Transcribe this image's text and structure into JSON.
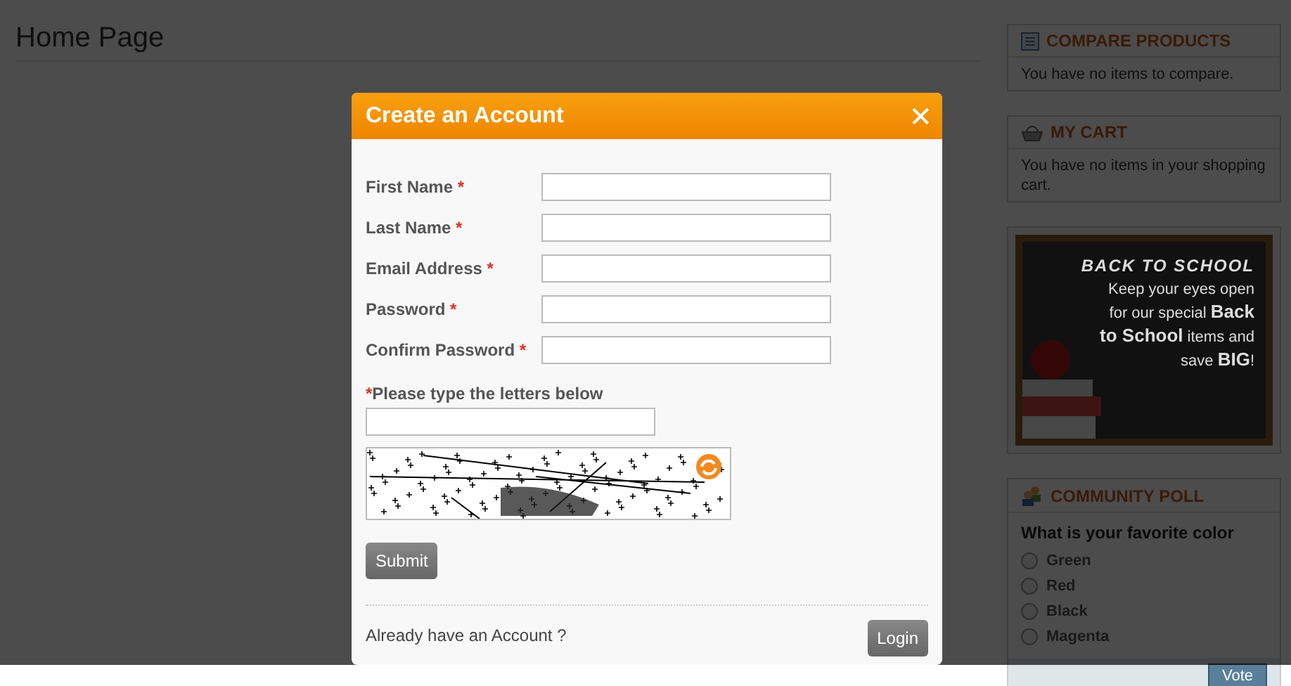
{
  "page": {
    "title": "Home Page"
  },
  "sidebar": {
    "compare": {
      "title": "COMPARE PRODUCTS",
      "text": "You have no items to compare."
    },
    "cart": {
      "title": "MY CART",
      "text": "You have no items in your shopping cart."
    },
    "banner": {
      "heading": "BACK TO SCHOOL",
      "text": "Keep your eyes open for our special **Back to School** items and save **BIG**!"
    },
    "poll": {
      "title": "COMMUNITY POLL",
      "question": "What is your favorite color",
      "options": [
        {
          "label": "Green",
          "selected": false
        },
        {
          "label": "Red",
          "selected": false
        },
        {
          "label": "Black",
          "selected": false
        },
        {
          "label": "Magenta",
          "selected": false
        }
      ],
      "button": "Vote"
    }
  },
  "dialog": {
    "title": "Create an Account",
    "close": "✕",
    "fields": [
      {
        "label": "First Name",
        "required_mark": "*"
      },
      {
        "label": "Last Name",
        "required_mark": "*"
      },
      {
        "label": "Email Address",
        "required_mark": "*"
      },
      {
        "label": "Password",
        "required_mark": "*"
      },
      {
        "label": "Confirm Password",
        "required_mark": "*"
      }
    ],
    "captcha": {
      "label": "Please type the letters below",
      "required_mark": "*"
    },
    "submit": "Submit",
    "login_prompt": "Already have an Account ?",
    "login": "Login"
  }
}
